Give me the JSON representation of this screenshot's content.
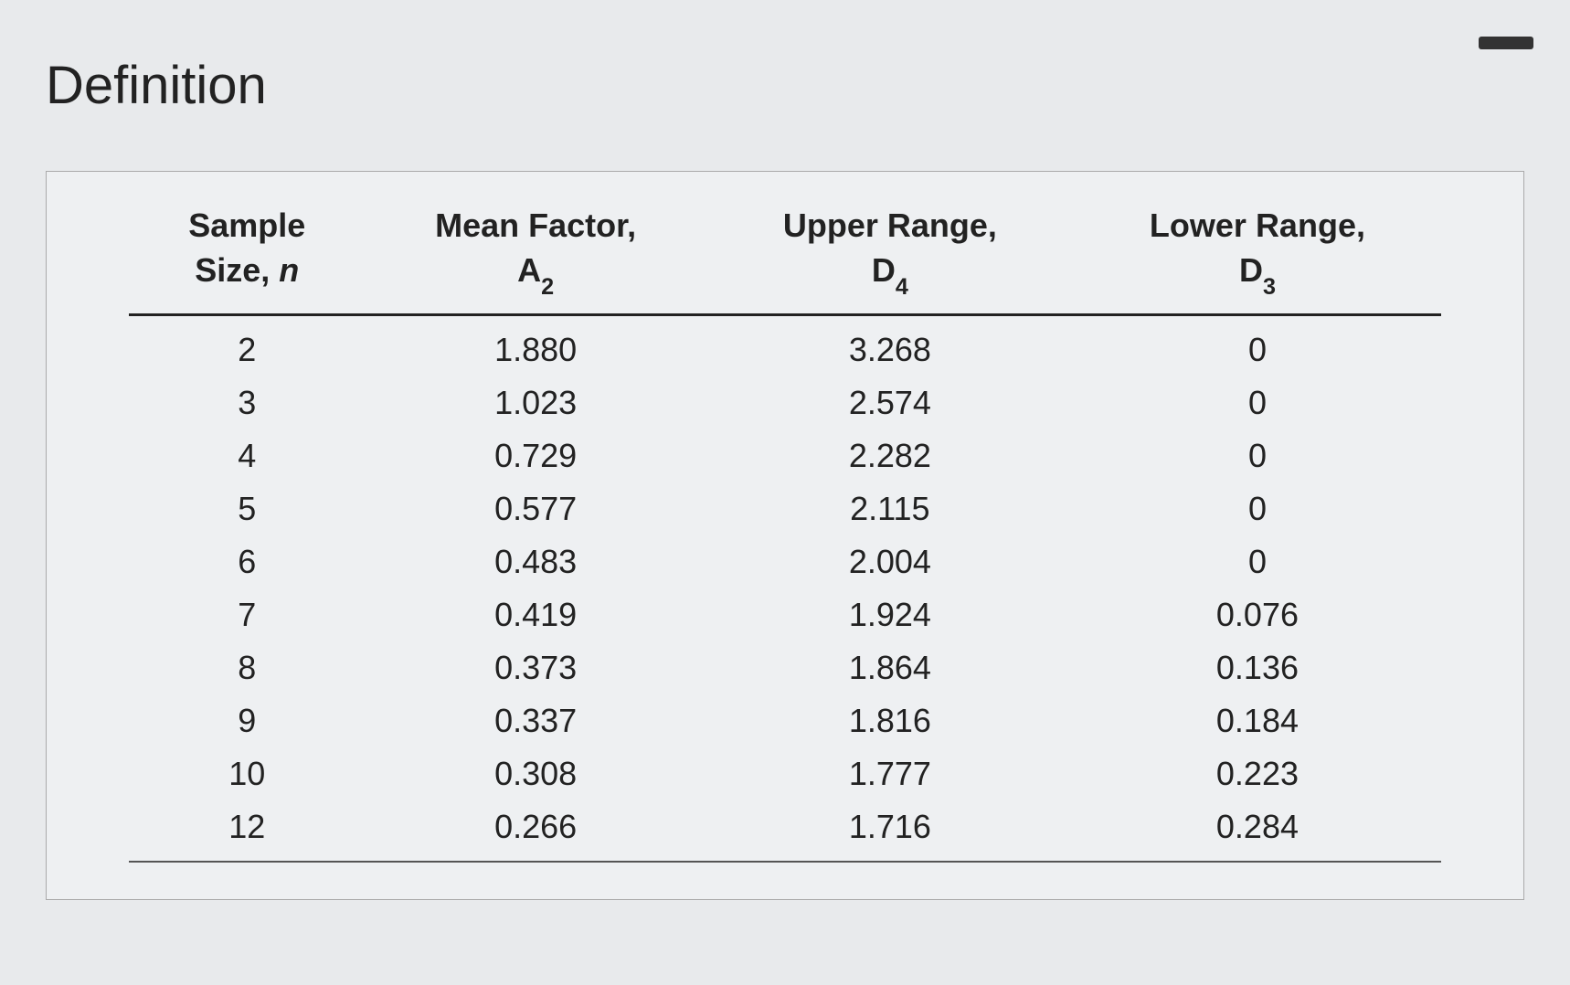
{
  "title": "Definition",
  "chart_data": {
    "type": "table",
    "columns": [
      {
        "label_line1": "Sample",
        "label_line2": "Size, ",
        "symbol": "n",
        "subscript": ""
      },
      {
        "label_line1": "Mean Factor,",
        "label_line2": "",
        "symbol": "A",
        "subscript": "2"
      },
      {
        "label_line1": "Upper Range,",
        "label_line2": "",
        "symbol": "D",
        "subscript": "4"
      },
      {
        "label_line1": "Lower Range,",
        "label_line2": "",
        "symbol": "D",
        "subscript": "3"
      }
    ],
    "rows": [
      {
        "n": "2",
        "a2": "1.880",
        "d4": "3.268",
        "d3": "0"
      },
      {
        "n": "3",
        "a2": "1.023",
        "d4": "2.574",
        "d3": "0"
      },
      {
        "n": "4",
        "a2": "0.729",
        "d4": "2.282",
        "d3": "0"
      },
      {
        "n": "5",
        "a2": "0.577",
        "d4": "2.115",
        "d3": "0"
      },
      {
        "n": "6",
        "a2": "0.483",
        "d4": "2.004",
        "d3": "0"
      },
      {
        "n": "7",
        "a2": "0.419",
        "d4": "1.924",
        "d3": "0.076"
      },
      {
        "n": "8",
        "a2": "0.373",
        "d4": "1.864",
        "d3": "0.136"
      },
      {
        "n": "9",
        "a2": "0.337",
        "d4": "1.816",
        "d3": "0.184"
      },
      {
        "n": "10",
        "a2": "0.308",
        "d4": "1.777",
        "d3": "0.223"
      },
      {
        "n": "12",
        "a2": "0.266",
        "d4": "1.716",
        "d3": "0.284"
      }
    ]
  }
}
